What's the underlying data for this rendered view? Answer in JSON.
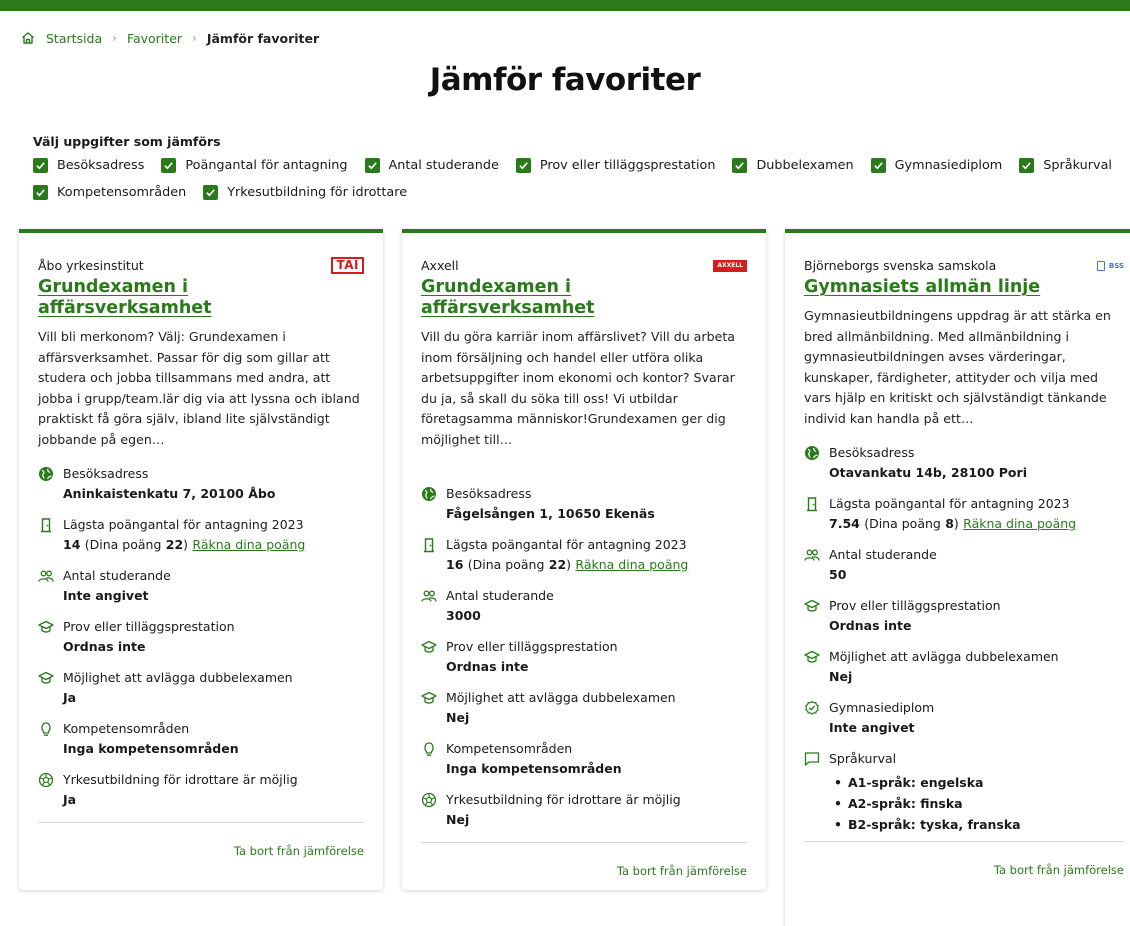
{
  "breadcrumb": {
    "home": "Startsida",
    "favorites": "Favoriter",
    "current": "Jämför favoriter"
  },
  "page_title": "Jämför favoriter",
  "filters": {
    "title": "Välj uppgifter som jämförs",
    "items": [
      "Besöksadress",
      "Poängantal för antagning",
      "Antal studerande",
      "Prov eller tilläggsprestation",
      "Dubbelexamen",
      "Gymnasiediplom",
      "Språkurval",
      "Kompetensområden",
      "Yrkesutbildning för idrottare"
    ]
  },
  "colors": {
    "accent": "#2a7a1c",
    "logo_red": "#d61c1c",
    "logo_blue": "#4a7ac7"
  },
  "cards": [
    {
      "provider": "Åbo yrkesinstitut",
      "logo": "TAI",
      "title": "Grundexamen i affärsverksamhet",
      "description": "Vill bli merkonom? Välj: Grundexamen i affärsverksamhet. Passar för dig som gillar att studera och jobba tillsammans med andra, att jobba i grupp/team.lär dig via att lyssna och ibland praktiskt få göra själv, ibland lite självständigt jobbande på egen…",
      "address_label": "Besöksadress",
      "address": "Aninkaistenkatu 7, 20100 Åbo",
      "points_label": "Lägsta poängantal för antagning 2023",
      "points": "14",
      "my_points_prefix": "(Dina poäng",
      "my_points": "22",
      "my_points_suffix": ")",
      "calc_link": "Räkna dina poäng",
      "students_label": "Antal studerande",
      "students": "Inte angivet",
      "exam_label": "Prov eller tilläggsprestation",
      "exam": "Ordnas inte",
      "double_label": "Möjlighet att avlägga dubbelexamen",
      "double": "Ja",
      "comp_label": "Kompetensområden",
      "comp": "Inga kompetensområden",
      "athlete_label": "Yrkesutbildning för idrottare är möjlig",
      "athlete": "Ja",
      "remove": "Ta bort från jämförelse"
    },
    {
      "provider": "Axxell",
      "logo": "AXXELL",
      "title": "Grundexamen i affärsverksamhet",
      "description": "Vill du göra karriär inom affärslivet? Vill du arbeta inom försäljning och handel eller utföra olika arbetsuppgifter inom ekonomi och kontor? Svarar du ja, så skall du söka till oss! Vi utbildar företagsamma människor!Grundexamen ger dig möjlighet till…",
      "address_label": "Besöksadress",
      "address": "Fågelsången 1, 10650 Ekenäs",
      "points_label": "Lägsta poängantal för antagning 2023",
      "points": "16",
      "my_points_prefix": "(Dina poäng",
      "my_points": "22",
      "my_points_suffix": ")",
      "calc_link": "Räkna dina poäng",
      "students_label": "Antal studerande",
      "students": "3000",
      "exam_label": "Prov eller tilläggsprestation",
      "exam": "Ordnas inte",
      "double_label": "Möjlighet att avlägga dubbelexamen",
      "double": "Nej",
      "comp_label": "Kompetensområden",
      "comp": "Inga kompetensområden",
      "athlete_label": "Yrkesutbildning för idrottare är möjlig",
      "athlete": "Nej",
      "remove": "Ta bort från jämförelse"
    },
    {
      "provider": "Björneborgs svenska samskola",
      "logo": "BSS",
      "title": "Gymnasiets allmän linje",
      "description": "Gymnasieutbildningens uppdrag är att stärka en bred allmänbildning. Med allmänbildning i gymnasieutbildningen avses värderingar, kunskaper, färdigheter, attityder och vilja med vars hjälp en kritiskt och självständigt tänkande individ kan handla på ett…",
      "address_label": "Besöksadress",
      "address": "Otavankatu 14b, 28100 Pori",
      "points_label": "Lägsta poängantal för antagning 2023",
      "points": "7.54",
      "my_points_prefix": "(Dina poäng",
      "my_points": "8",
      "my_points_suffix": ")",
      "calc_link": "Räkna dina poäng",
      "students_label": "Antal studerande",
      "students": "50",
      "exam_label": "Prov eller tilläggsprestation",
      "exam": "Ordnas inte",
      "double_label": "Möjlighet att avlägga dubbelexamen",
      "double": "Nej",
      "diploma_label": "Gymnasiediplom",
      "diploma": "Inte angivet",
      "lang_label": "Språkurval",
      "langs": [
        "A1-språk:  engelska",
        "A2-språk:  finska",
        "B2-språk:  tyska, franska"
      ],
      "remove": "Ta bort från jämförelse"
    }
  ]
}
